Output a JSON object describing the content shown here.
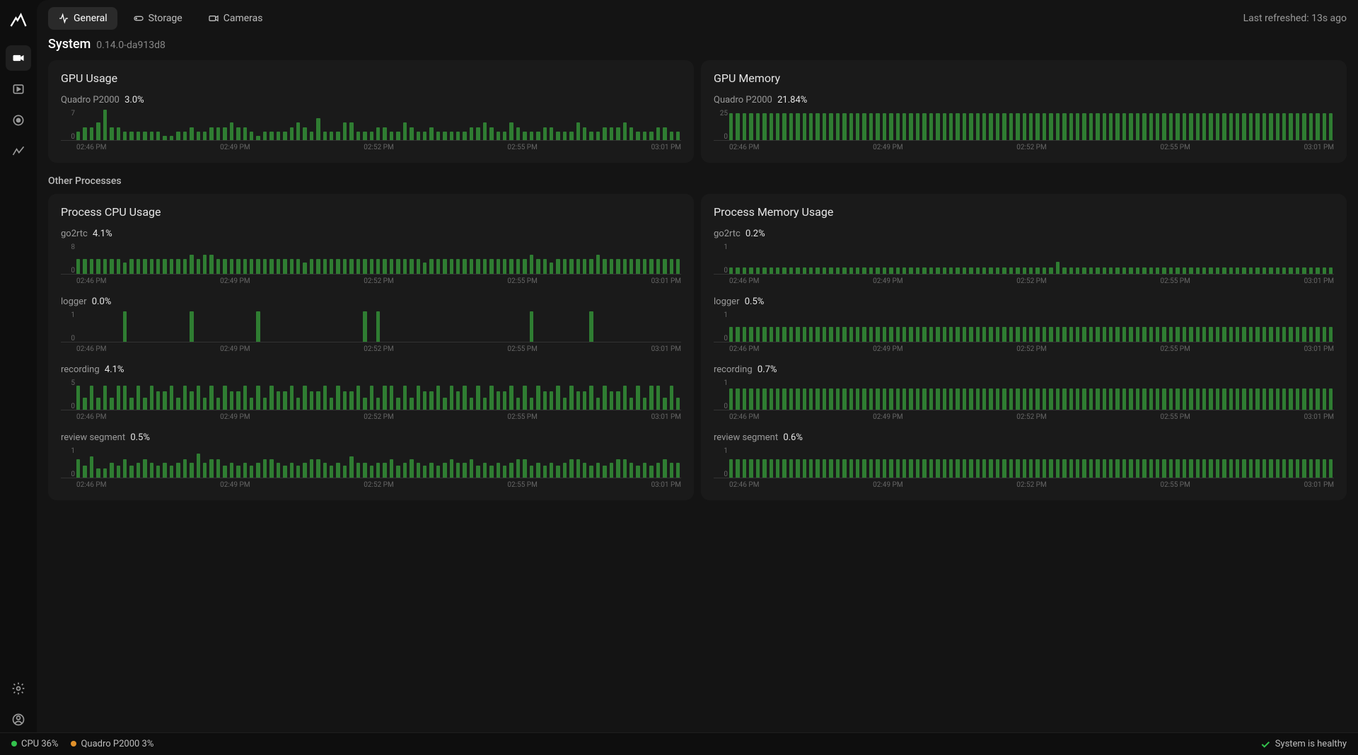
{
  "sidebar": {
    "items": [
      {
        "name": "camera"
      },
      {
        "name": "clip"
      },
      {
        "name": "record"
      },
      {
        "name": "activity"
      }
    ]
  },
  "tabs": {
    "general": "General",
    "storage": "Storage",
    "cameras": "Cameras"
  },
  "refresh": "Last refreshed: 13s ago",
  "page": {
    "title": "System",
    "version": "0.14.0-da913d8"
  },
  "section_other": "Other Processes",
  "xticks": [
    "02:46 PM",
    "02:49 PM",
    "02:52 PM",
    "02:55 PM",
    "03:01 PM"
  ],
  "gpu_usage": {
    "title": "GPU Usage",
    "label": "Quadro P2000",
    "value": "3.0%"
  },
  "gpu_memory": {
    "title": "GPU Memory",
    "label": "Quadro P2000",
    "value": "21.84%"
  },
  "proc_cpu": {
    "title": "Process CPU Usage",
    "items": [
      {
        "label": "go2rtc",
        "value": "4.1%"
      },
      {
        "label": "logger",
        "value": "0.0%"
      },
      {
        "label": "recording",
        "value": "4.1%"
      },
      {
        "label": "review segment",
        "value": "0.5%"
      }
    ]
  },
  "proc_mem": {
    "title": "Process Memory Usage",
    "items": [
      {
        "label": "go2rtc",
        "value": "0.2%"
      },
      {
        "label": "logger",
        "value": "0.5%"
      },
      {
        "label": "recording",
        "value": "0.7%"
      },
      {
        "label": "review segment",
        "value": "0.6%"
      }
    ]
  },
  "status": {
    "cpu": "CPU 36%",
    "gpu": "Quadro P2000 3%",
    "health": "System is healthy"
  },
  "chart_data": [
    {
      "type": "bar",
      "title": "GPU Usage — Quadro P2000 (%)",
      "x": [
        "02:46 PM",
        "02:49 PM",
        "02:52 PM",
        "02:55 PM",
        "03:01 PM"
      ],
      "ylim": [
        0,
        7
      ],
      "values": [
        2,
        3,
        3,
        4,
        7,
        3,
        3,
        2,
        2,
        2,
        2,
        2,
        2,
        1,
        1,
        2,
        2,
        3,
        2,
        2,
        3,
        3,
        3,
        4,
        3,
        3,
        2,
        1,
        2,
        2,
        2,
        2,
        3,
        4,
        3,
        2,
        5,
        2,
        2,
        2,
        4,
        4,
        2,
        2,
        2,
        3,
        3,
        2,
        2,
        4,
        3,
        2,
        2,
        3,
        2,
        2,
        2,
        2,
        2,
        3,
        3,
        4,
        3,
        2,
        2,
        4,
        3,
        2,
        2,
        2,
        3,
        3,
        2,
        2,
        2,
        4,
        3,
        2,
        2,
        3,
        3,
        3,
        4,
        3,
        2,
        2,
        2,
        3,
        3,
        2,
        2
      ],
      "ylabel": "%"
    },
    {
      "type": "bar",
      "title": "GPU Memory — Quadro P2000 (%)",
      "x": [
        "02:46 PM",
        "02:49 PM",
        "02:52 PM",
        "02:55 PM",
        "03:01 PM"
      ],
      "ylim": [
        0,
        25
      ],
      "values": [
        22,
        22,
        22,
        22,
        22,
        22,
        22,
        22,
        22,
        22,
        22,
        22,
        22,
        22,
        22,
        22,
        22,
        22,
        22,
        22,
        22,
        22,
        22,
        22,
        22,
        22,
        22,
        22,
        22,
        22,
        22,
        22,
        22,
        22,
        22,
        22,
        22,
        22,
        22,
        22,
        22,
        22,
        22,
        22,
        22,
        22,
        22,
        22,
        22,
        22,
        22,
        22,
        22,
        22,
        22,
        22,
        22,
        22,
        22,
        22,
        22,
        22,
        22,
        22,
        22,
        22,
        22,
        22,
        22,
        22,
        22,
        22,
        22,
        22,
        22,
        22,
        22,
        22,
        22,
        22,
        22,
        22,
        22,
        22,
        22,
        22,
        22,
        22,
        22,
        22,
        22
      ],
      "ylabel": "%"
    },
    {
      "type": "bar",
      "title": "Process CPU Usage — go2rtc (%)",
      "x": [
        "02:46 PM",
        "02:49 PM",
        "02:52 PM",
        "02:55 PM",
        "03:01 PM"
      ],
      "ylim": [
        0,
        8
      ],
      "values": [
        4,
        4,
        4,
        4,
        4,
        4,
        4,
        3,
        4,
        4,
        4,
        4,
        4,
        4,
        4,
        4,
        4,
        5,
        4,
        5,
        5,
        4,
        4,
        4,
        4,
        4,
        4,
        4,
        4,
        4,
        4,
        4,
        4,
        4,
        3,
        4,
        4,
        4,
        4,
        4,
        4,
        4,
        4,
        4,
        4,
        4,
        4,
        4,
        4,
        4,
        4,
        4,
        3,
        4,
        4,
        4,
        4,
        4,
        4,
        4,
        4,
        4,
        4,
        4,
        4,
        4,
        4,
        4,
        5,
        4,
        4,
        3,
        4,
        4,
        4,
        4,
        4,
        4,
        5,
        4,
        4,
        4,
        4,
        4,
        4,
        4,
        4,
        4,
        4,
        4,
        4
      ],
      "ylabel": "%"
    },
    {
      "type": "bar",
      "title": "Process CPU Usage — logger (%)",
      "x": [
        "02:46 PM",
        "02:49 PM",
        "02:52 PM",
        "02:55 PM",
        "03:01 PM"
      ],
      "ylim": [
        0,
        1
      ],
      "values": [
        0,
        0,
        0,
        0,
        0,
        0,
        0,
        1,
        0,
        0,
        0,
        0,
        0,
        0,
        0,
        0,
        0,
        1,
        0,
        0,
        0,
        0,
        0,
        0,
        0,
        0,
        0,
        1,
        0,
        0,
        0,
        0,
        0,
        0,
        0,
        0,
        0,
        0,
        0,
        0,
        0,
        0,
        0,
        1,
        0,
        1,
        0,
        0,
        0,
        0,
        0,
        0,
        0,
        0,
        0,
        0,
        0,
        0,
        0,
        0,
        0,
        0,
        0,
        0,
        0,
        0,
        0,
        0,
        1,
        0,
        0,
        0,
        0,
        0,
        0,
        0,
        0,
        1,
        0,
        0,
        0,
        0,
        0,
        0,
        0,
        0,
        0,
        0,
        0,
        0,
        0
      ],
      "ylabel": "%"
    },
    {
      "type": "bar",
      "title": "Process CPU Usage — recording (%)",
      "x": [
        "02:46 PM",
        "02:49 PM",
        "02:52 PM",
        "02:55 PM",
        "03:01 PM"
      ],
      "ylim": [
        0,
        5
      ],
      "values": [
        4,
        2,
        4,
        2,
        4,
        2,
        4,
        4,
        2,
        4,
        2,
        4,
        3,
        3,
        4,
        2,
        4,
        3,
        4,
        2,
        4,
        2,
        4,
        3,
        3,
        4,
        2,
        4,
        2,
        4,
        3,
        3,
        4,
        2,
        4,
        3,
        3,
        4,
        2,
        4,
        3,
        3,
        4,
        2,
        4,
        2,
        4,
        4,
        2,
        4,
        2,
        4,
        3,
        3,
        4,
        2,
        4,
        3,
        4,
        2,
        4,
        2,
        4,
        3,
        3,
        4,
        2,
        4,
        2,
        4,
        3,
        3,
        4,
        2,
        4,
        3,
        3,
        4,
        2,
        4,
        3,
        3,
        4,
        2,
        4,
        2,
        4,
        4,
        2,
        4,
        2
      ],
      "ylabel": "%"
    },
    {
      "type": "bar",
      "title": "Process CPU Usage — review segment (%)",
      "x": [
        "02:46 PM",
        "02:49 PM",
        "02:52 PM",
        "02:55 PM",
        "03:01 PM"
      ],
      "ylim": [
        0,
        1
      ],
      "values": [
        0.6,
        0.4,
        0.7,
        0.3,
        0.3,
        0.5,
        0.4,
        0.6,
        0.4,
        0.5,
        0.6,
        0.5,
        0.4,
        0.5,
        0.4,
        0.5,
        0.6,
        0.5,
        0.8,
        0.5,
        0.6,
        0.6,
        0.4,
        0.5,
        0.4,
        0.5,
        0.4,
        0.5,
        0.6,
        0.6,
        0.5,
        0.4,
        0.5,
        0.4,
        0.5,
        0.6,
        0.6,
        0.5,
        0.4,
        0.5,
        0.4,
        0.7,
        0.5,
        0.5,
        0.4,
        0.5,
        0.5,
        0.6,
        0.4,
        0.5,
        0.6,
        0.5,
        0.4,
        0.5,
        0.4,
        0.5,
        0.6,
        0.5,
        0.5,
        0.6,
        0.4,
        0.5,
        0.4,
        0.5,
        0.4,
        0.5,
        0.6,
        0.6,
        0.4,
        0.5,
        0.4,
        0.5,
        0.4,
        0.5,
        0.6,
        0.6,
        0.5,
        0.4,
        0.5,
        0.4,
        0.5,
        0.6,
        0.6,
        0.5,
        0.4,
        0.5,
        0.4,
        0.5,
        0.6,
        0.5,
        0.5
      ],
      "ylabel": "%"
    },
    {
      "type": "bar",
      "title": "Process Memory Usage — go2rtc (%)",
      "x": [
        "02:46 PM",
        "02:49 PM",
        "02:52 PM",
        "02:55 PM",
        "03:01 PM"
      ],
      "ylim": [
        0,
        1
      ],
      "values": [
        0.2,
        0.2,
        0.2,
        0.2,
        0.2,
        0.2,
        0.2,
        0.2,
        0.2,
        0.2,
        0.2,
        0.2,
        0.2,
        0.2,
        0.2,
        0.2,
        0.2,
        0.2,
        0.2,
        0.2,
        0.2,
        0.2,
        0.2,
        0.2,
        0.2,
        0.2,
        0.2,
        0.2,
        0.2,
        0.2,
        0.2,
        0.2,
        0.2,
        0.2,
        0.2,
        0.2,
        0.2,
        0.2,
        0.2,
        0.2,
        0.2,
        0.2,
        0.2,
        0.2,
        0.2,
        0.2,
        0.2,
        0.2,
        0.2,
        0.4,
        0.2,
        0.2,
        0.2,
        0.2,
        0.2,
        0.2,
        0.2,
        0.2,
        0.2,
        0.2,
        0.2,
        0.2,
        0.2,
        0.2,
        0.2,
        0.2,
        0.2,
        0.2,
        0.2,
        0.2,
        0.2,
        0.2,
        0.2,
        0.2,
        0.2,
        0.2,
        0.2,
        0.2,
        0.2,
        0.2,
        0.2,
        0.2,
        0.2,
        0.2,
        0.2,
        0.2,
        0.2,
        0.2,
        0.2,
        0.2,
        0.2
      ],
      "ylabel": "%"
    },
    {
      "type": "bar",
      "title": "Process Memory Usage — logger (%)",
      "x": [
        "02:46 PM",
        "02:49 PM",
        "02:52 PM",
        "02:55 PM",
        "03:01 PM"
      ],
      "ylim": [
        0,
        1
      ],
      "values": [
        0.5,
        0.5,
        0.5,
        0.5,
        0.5,
        0.5,
        0.5,
        0.5,
        0.5,
        0.5,
        0.5,
        0.5,
        0.5,
        0.5,
        0.5,
        0.5,
        0.5,
        0.5,
        0.5,
        0.5,
        0.5,
        0.5,
        0.5,
        0.5,
        0.5,
        0.5,
        0.5,
        0.5,
        0.5,
        0.5,
        0.5,
        0.5,
        0.5,
        0.5,
        0.5,
        0.5,
        0.5,
        0.5,
        0.5,
        0.5,
        0.5,
        0.5,
        0.5,
        0.5,
        0.5,
        0.5,
        0.5,
        0.5,
        0.5,
        0.5,
        0.5,
        0.5,
        0.5,
        0.5,
        0.5,
        0.5,
        0.5,
        0.5,
        0.5,
        0.5,
        0.5,
        0.5,
        0.5,
        0.5,
        0.5,
        0.5,
        0.5,
        0.5,
        0.5,
        0.5,
        0.5,
        0.5,
        0.5,
        0.5,
        0.5,
        0.5,
        0.5,
        0.5,
        0.5,
        0.5,
        0.5,
        0.5,
        0.5,
        0.5,
        0.5,
        0.5,
        0.5,
        0.5,
        0.5,
        0.5,
        0.5
      ],
      "ylabel": "%"
    },
    {
      "type": "bar",
      "title": "Process Memory Usage — recording (%)",
      "x": [
        "02:46 PM",
        "02:49 PM",
        "02:52 PM",
        "02:55 PM",
        "03:01 PM"
      ],
      "ylim": [
        0,
        1
      ],
      "values": [
        0.7,
        0.7,
        0.7,
        0.7,
        0.7,
        0.7,
        0.7,
        0.7,
        0.7,
        0.7,
        0.7,
        0.7,
        0.7,
        0.7,
        0.7,
        0.7,
        0.7,
        0.7,
        0.7,
        0.7,
        0.7,
        0.7,
        0.7,
        0.7,
        0.7,
        0.7,
        0.7,
        0.7,
        0.7,
        0.7,
        0.7,
        0.7,
        0.7,
        0.7,
        0.7,
        0.7,
        0.7,
        0.7,
        0.7,
        0.7,
        0.7,
        0.7,
        0.7,
        0.7,
        0.7,
        0.7,
        0.7,
        0.7,
        0.7,
        0.7,
        0.7,
        0.7,
        0.7,
        0.7,
        0.7,
        0.7,
        0.7,
        0.7,
        0.7,
        0.7,
        0.7,
        0.7,
        0.7,
        0.7,
        0.7,
        0.7,
        0.7,
        0.7,
        0.7,
        0.7,
        0.7,
        0.7,
        0.7,
        0.7,
        0.7,
        0.7,
        0.7,
        0.7,
        0.7,
        0.7,
        0.7,
        0.7,
        0.7,
        0.7,
        0.7,
        0.7,
        0.7,
        0.7,
        0.7,
        0.7,
        0.7
      ],
      "ylabel": "%"
    },
    {
      "type": "bar",
      "title": "Process Memory Usage — review segment (%)",
      "x": [
        "02:46 PM",
        "02:49 PM",
        "02:52 PM",
        "02:55 PM",
        "03:01 PM"
      ],
      "ylim": [
        0,
        1
      ],
      "values": [
        0.6,
        0.6,
        0.6,
        0.6,
        0.6,
        0.6,
        0.6,
        0.6,
        0.6,
        0.6,
        0.6,
        0.6,
        0.6,
        0.6,
        0.6,
        0.6,
        0.6,
        0.6,
        0.6,
        0.6,
        0.6,
        0.6,
        0.6,
        0.6,
        0.6,
        0.6,
        0.6,
        0.6,
        0.6,
        0.6,
        0.6,
        0.6,
        0.6,
        0.6,
        0.6,
        0.6,
        0.6,
        0.6,
        0.6,
        0.6,
        0.6,
        0.6,
        0.6,
        0.6,
        0.6,
        0.6,
        0.6,
        0.6,
        0.6,
        0.6,
        0.6,
        0.6,
        0.6,
        0.6,
        0.6,
        0.6,
        0.6,
        0.6,
        0.6,
        0.6,
        0.6,
        0.6,
        0.6,
        0.6,
        0.6,
        0.6,
        0.6,
        0.6,
        0.6,
        0.6,
        0.6,
        0.6,
        0.6,
        0.6,
        0.6,
        0.6,
        0.6,
        0.6,
        0.6,
        0.6,
        0.6,
        0.6,
        0.6,
        0.6,
        0.6,
        0.6,
        0.6,
        0.6,
        0.6,
        0.6,
        0.6
      ],
      "ylabel": "%"
    }
  ]
}
